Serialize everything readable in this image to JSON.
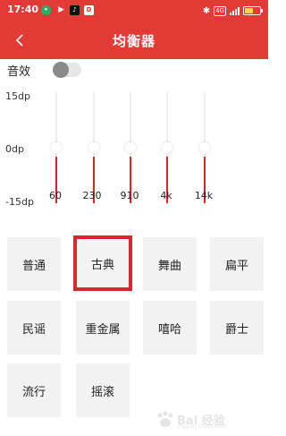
{
  "status_bar": {
    "time": "17:40",
    "network": "4G",
    "battery_level": 0.55,
    "colors": {
      "background": "#e23b36",
      "battery": "#ffd54a"
    },
    "icons": [
      "wechat-icon",
      "arrow-icon",
      "tiktok-icon",
      "d-app-icon",
      "bluetooth-icon",
      "network-4g-icon",
      "signal-icon",
      "battery-icon"
    ]
  },
  "header": {
    "title": "均衡器",
    "back_icon": "chevron-left-icon",
    "color": "#e23b36"
  },
  "sound_effect": {
    "label": "音效",
    "enabled": false
  },
  "equalizer": {
    "scale_labels": {
      "top": "15dp",
      "middle": "0dp",
      "bottom": "-15dp"
    },
    "range": [
      -15,
      15
    ],
    "bands": [
      {
        "freq": "60",
        "level": 0
      },
      {
        "freq": "230",
        "level": 0
      },
      {
        "freq": "910",
        "level": 0
      },
      {
        "freq": "4k",
        "level": 0
      },
      {
        "freq": "14k",
        "level": 0
      }
    ],
    "accent_color": "#d62626"
  },
  "presets": {
    "selected": "古典",
    "items": [
      "普通",
      "古典",
      "舞曲",
      "扁平",
      "民谣",
      "重金属",
      "嘻哈",
      "爵士",
      "流行",
      "摇滚"
    ]
  },
  "watermark": {
    "text": "Bai 经验",
    "sub": "jingyan.baidu.com"
  }
}
